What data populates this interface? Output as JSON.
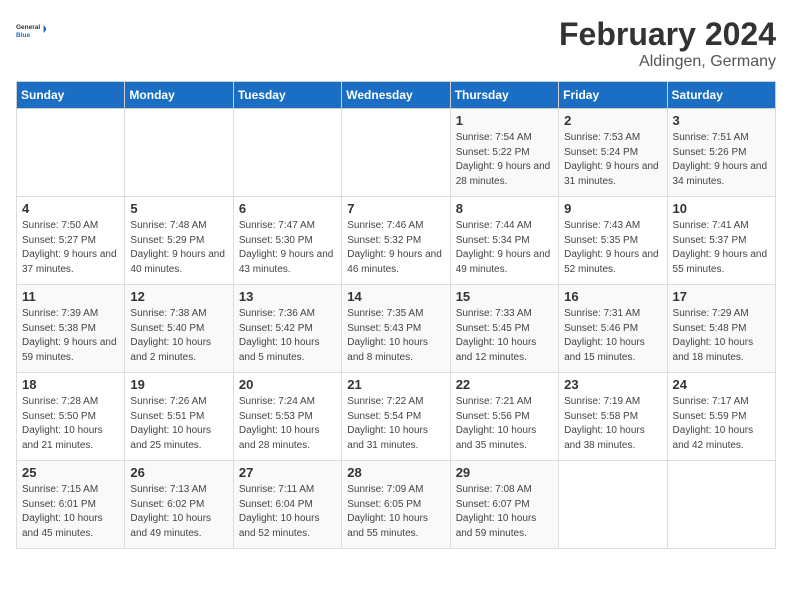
{
  "header": {
    "logo_general": "General",
    "logo_blue": "Blue",
    "month_title": "February 2024",
    "location": "Aldingen, Germany"
  },
  "calendar": {
    "days_of_week": [
      "Sunday",
      "Monday",
      "Tuesday",
      "Wednesday",
      "Thursday",
      "Friday",
      "Saturday"
    ],
    "weeks": [
      [
        {
          "day": "",
          "info": ""
        },
        {
          "day": "",
          "info": ""
        },
        {
          "day": "",
          "info": ""
        },
        {
          "day": "",
          "info": ""
        },
        {
          "day": "1",
          "info": "Sunrise: 7:54 AM\nSunset: 5:22 PM\nDaylight: 9 hours and 28 minutes."
        },
        {
          "day": "2",
          "info": "Sunrise: 7:53 AM\nSunset: 5:24 PM\nDaylight: 9 hours and 31 minutes."
        },
        {
          "day": "3",
          "info": "Sunrise: 7:51 AM\nSunset: 5:26 PM\nDaylight: 9 hours and 34 minutes."
        }
      ],
      [
        {
          "day": "4",
          "info": "Sunrise: 7:50 AM\nSunset: 5:27 PM\nDaylight: 9 hours and 37 minutes."
        },
        {
          "day": "5",
          "info": "Sunrise: 7:48 AM\nSunset: 5:29 PM\nDaylight: 9 hours and 40 minutes."
        },
        {
          "day": "6",
          "info": "Sunrise: 7:47 AM\nSunset: 5:30 PM\nDaylight: 9 hours and 43 minutes."
        },
        {
          "day": "7",
          "info": "Sunrise: 7:46 AM\nSunset: 5:32 PM\nDaylight: 9 hours and 46 minutes."
        },
        {
          "day": "8",
          "info": "Sunrise: 7:44 AM\nSunset: 5:34 PM\nDaylight: 9 hours and 49 minutes."
        },
        {
          "day": "9",
          "info": "Sunrise: 7:43 AM\nSunset: 5:35 PM\nDaylight: 9 hours and 52 minutes."
        },
        {
          "day": "10",
          "info": "Sunrise: 7:41 AM\nSunset: 5:37 PM\nDaylight: 9 hours and 55 minutes."
        }
      ],
      [
        {
          "day": "11",
          "info": "Sunrise: 7:39 AM\nSunset: 5:38 PM\nDaylight: 9 hours and 59 minutes."
        },
        {
          "day": "12",
          "info": "Sunrise: 7:38 AM\nSunset: 5:40 PM\nDaylight: 10 hours and 2 minutes."
        },
        {
          "day": "13",
          "info": "Sunrise: 7:36 AM\nSunset: 5:42 PM\nDaylight: 10 hours and 5 minutes."
        },
        {
          "day": "14",
          "info": "Sunrise: 7:35 AM\nSunset: 5:43 PM\nDaylight: 10 hours and 8 minutes."
        },
        {
          "day": "15",
          "info": "Sunrise: 7:33 AM\nSunset: 5:45 PM\nDaylight: 10 hours and 12 minutes."
        },
        {
          "day": "16",
          "info": "Sunrise: 7:31 AM\nSunset: 5:46 PM\nDaylight: 10 hours and 15 minutes."
        },
        {
          "day": "17",
          "info": "Sunrise: 7:29 AM\nSunset: 5:48 PM\nDaylight: 10 hours and 18 minutes."
        }
      ],
      [
        {
          "day": "18",
          "info": "Sunrise: 7:28 AM\nSunset: 5:50 PM\nDaylight: 10 hours and 21 minutes."
        },
        {
          "day": "19",
          "info": "Sunrise: 7:26 AM\nSunset: 5:51 PM\nDaylight: 10 hours and 25 minutes."
        },
        {
          "day": "20",
          "info": "Sunrise: 7:24 AM\nSunset: 5:53 PM\nDaylight: 10 hours and 28 minutes."
        },
        {
          "day": "21",
          "info": "Sunrise: 7:22 AM\nSunset: 5:54 PM\nDaylight: 10 hours and 31 minutes."
        },
        {
          "day": "22",
          "info": "Sunrise: 7:21 AM\nSunset: 5:56 PM\nDaylight: 10 hours and 35 minutes."
        },
        {
          "day": "23",
          "info": "Sunrise: 7:19 AM\nSunset: 5:58 PM\nDaylight: 10 hours and 38 minutes."
        },
        {
          "day": "24",
          "info": "Sunrise: 7:17 AM\nSunset: 5:59 PM\nDaylight: 10 hours and 42 minutes."
        }
      ],
      [
        {
          "day": "25",
          "info": "Sunrise: 7:15 AM\nSunset: 6:01 PM\nDaylight: 10 hours and 45 minutes."
        },
        {
          "day": "26",
          "info": "Sunrise: 7:13 AM\nSunset: 6:02 PM\nDaylight: 10 hours and 49 minutes."
        },
        {
          "day": "27",
          "info": "Sunrise: 7:11 AM\nSunset: 6:04 PM\nDaylight: 10 hours and 52 minutes."
        },
        {
          "day": "28",
          "info": "Sunrise: 7:09 AM\nSunset: 6:05 PM\nDaylight: 10 hours and 55 minutes."
        },
        {
          "day": "29",
          "info": "Sunrise: 7:08 AM\nSunset: 6:07 PM\nDaylight: 10 hours and 59 minutes."
        },
        {
          "day": "",
          "info": ""
        },
        {
          "day": "",
          "info": ""
        }
      ]
    ]
  }
}
